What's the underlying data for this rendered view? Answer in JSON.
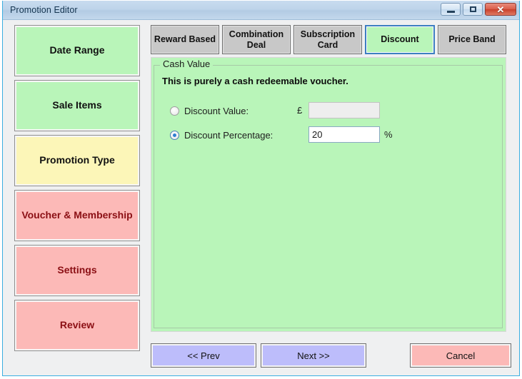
{
  "window": {
    "title": "Promotion Editor",
    "controls": {
      "minimize": "minimize-icon",
      "maximize": "maximize-icon",
      "close": "✕"
    },
    "accent_border": "#3aaee0"
  },
  "sidebar": {
    "items": [
      {
        "label": "Date Range",
        "state": "complete",
        "color": "#b9f5b9"
      },
      {
        "label": "Sale Items",
        "state": "complete",
        "color": "#b9f5b9"
      },
      {
        "label": "Promotion Type",
        "state": "current",
        "color": "#fcf6b8"
      },
      {
        "label": "Voucher & Membership",
        "state": "pending",
        "color": "#fcb9b7"
      },
      {
        "label": "Settings",
        "state": "pending",
        "color": "#fcb9b7"
      },
      {
        "label": "Review",
        "state": "pending",
        "color": "#fcb9b7"
      }
    ]
  },
  "tabs": [
    {
      "label": "Reward Based",
      "active": false
    },
    {
      "label": "Combination Deal",
      "active": false
    },
    {
      "label": "Subscription Card",
      "active": false
    },
    {
      "label": "Discount",
      "active": true
    },
    {
      "label": "Price Band",
      "active": false
    }
  ],
  "panel": {
    "group_label": "Cash Value",
    "headline": "This is purely a cash redeemable voucher.",
    "fields": {
      "discount_value": {
        "label": "Discount Value:",
        "selected": false,
        "unit": "£",
        "value": "",
        "enabled": false
      },
      "discount_percentage": {
        "label": "Discount Percentage:",
        "selected": true,
        "unit": "%",
        "value": "20",
        "enabled": true
      }
    }
  },
  "footer": {
    "prev_label": "<< Prev",
    "next_label": "Next >>",
    "cancel_label": "Cancel"
  }
}
